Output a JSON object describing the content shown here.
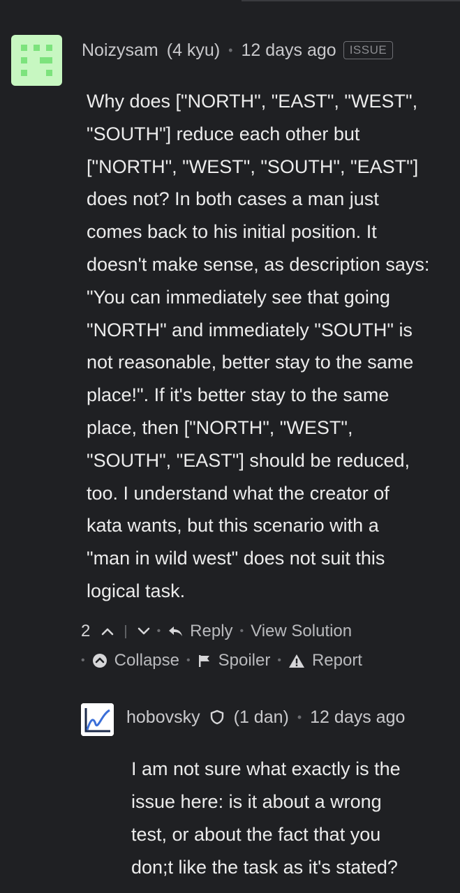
{
  "comment": {
    "author": "Noizysam",
    "rank": "(4 kyu)",
    "time": "12 days ago",
    "badge": "ISSUE",
    "avatar_icon": "identicon-avatar",
    "body_lines": [
      "Why does [\"NORTH\", \"EAST\", \"WEST\",",
      "\"SOUTH\"] reduce each other but",
      "[\"NORTH\", \"WEST\", \"SOUTH\", \"EAST\"]",
      "does not? In both cases a man just",
      "comes back to his initial position. It",
      "doesn't make sense, as description says:",
      "\"You can immediately see that going",
      "\"NORTH\" and immediately \"SOUTH\" is",
      "not reasonable, better stay to the same",
      "place!\". If it's better stay to the same",
      "place, then [\"NORTH\", \"WEST\",",
      "\"SOUTH\", \"EAST\"] should be reduced,",
      "too. I understand what the creator of",
      "kata wants, but this scenario with a",
      "\"man in wild west\" does not suit this",
      "logical task."
    ],
    "votes": "2",
    "actions": {
      "reply": "Reply",
      "view_solution": "View Solution",
      "collapse": "Collapse",
      "spoiler": "Spoiler",
      "report": "Report"
    }
  },
  "reply": {
    "author": "hobovsky",
    "rank": "(1 dan)",
    "time": "12 days ago",
    "avatar_icon": "chart-avatar",
    "body_lines": [
      "I am not sure what exactly is the",
      "issue here: is it about a wrong",
      "test, or about the fact that you",
      "don;t like the task as it's stated?"
    ]
  },
  "colors": {
    "background": "#1f2023",
    "text": "#ececec",
    "muted": "#b9babd",
    "avatar_green": "#c7f7c1",
    "avatar_green_dark": "#7de37d"
  }
}
